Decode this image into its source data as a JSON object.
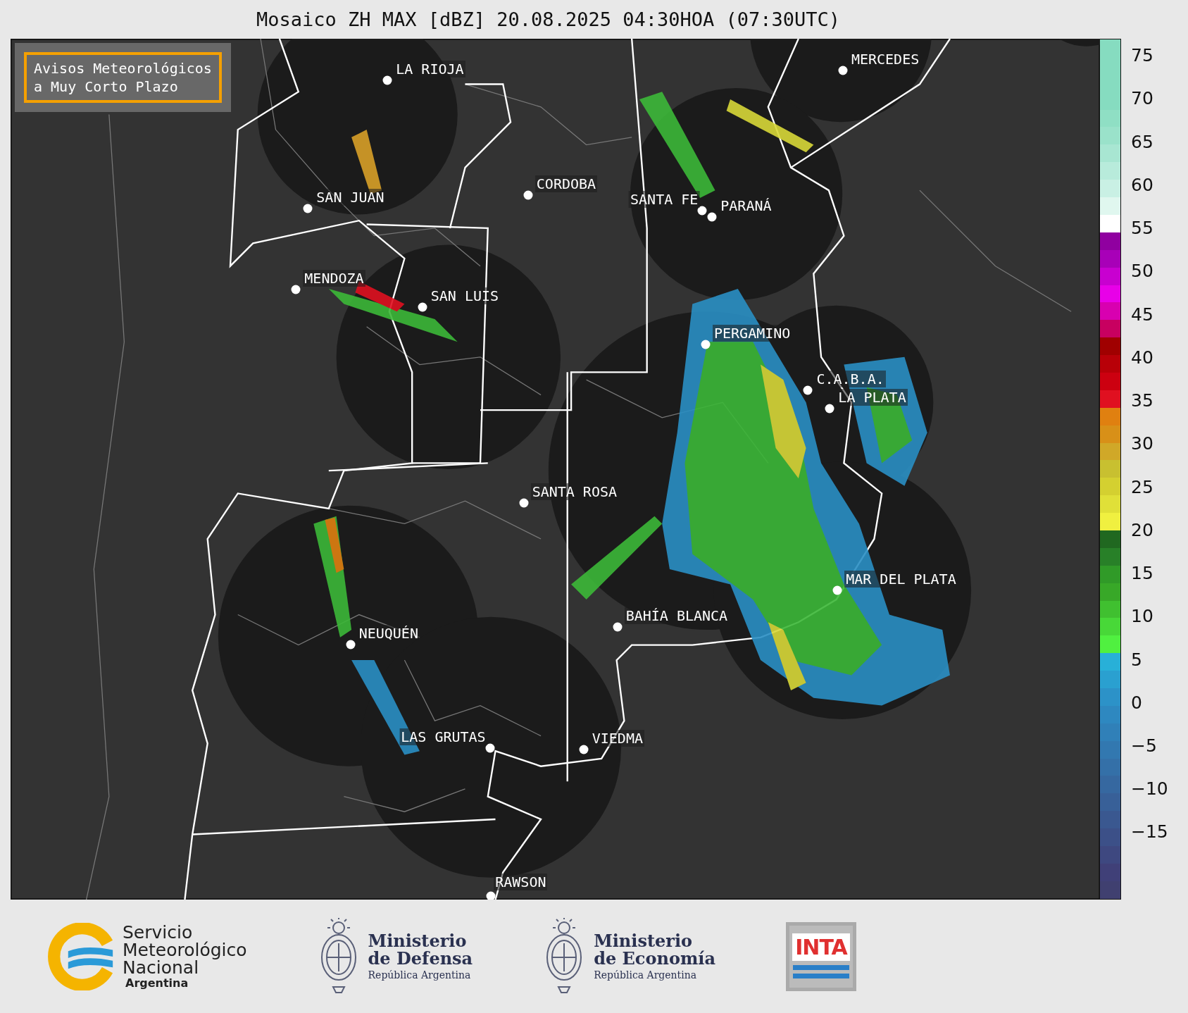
{
  "title": "Mosaico ZH MAX [dBZ] 20.08.2025 04:30HOA (07:30UTC)",
  "notice": "Avisos Meteorológicos\na Muy Corto Plazo",
  "cities": [
    {
      "name": "LA RIOJA"
    },
    {
      "name": "MERCEDES"
    },
    {
      "name": "SAN JUAN"
    },
    {
      "name": "CORDOBA"
    },
    {
      "name": "SANTA FE"
    },
    {
      "name": "PARANÁ"
    },
    {
      "name": "MENDOZA"
    },
    {
      "name": "SAN LUIS"
    },
    {
      "name": "PERGAMINO"
    },
    {
      "name": "C.A.B.A."
    },
    {
      "name": "LA PLATA"
    },
    {
      "name": "SANTA ROSA"
    },
    {
      "name": "MAR DEL PLATA"
    },
    {
      "name": "BAHÍA BLANCA"
    },
    {
      "name": "NEUQUÉN"
    },
    {
      "name": "LAS GRUTAS"
    },
    {
      "name": "VIEDMA"
    },
    {
      "name": "RAWSON"
    }
  ],
  "colorbar": {
    "ticks": [
      "75",
      "70",
      "65",
      "60",
      "55",
      "50",
      "45",
      "40",
      "35",
      "30",
      "25",
      "20",
      "15",
      "10",
      "5",
      "0",
      "−5",
      "−10",
      "−15"
    ]
  },
  "footer": {
    "smn": {
      "name_lines": [
        "Servicio",
        "Meteorológico",
        "Nacional"
      ],
      "subtitle": "Argentina"
    },
    "ministries": [
      {
        "line1": "Ministerio",
        "line2": "de Defensa",
        "subtitle": "República Argentina"
      },
      {
        "line1": "Ministerio",
        "line2": "de Economía",
        "subtitle": "República Argentina"
      }
    ],
    "inta": "INTA"
  }
}
